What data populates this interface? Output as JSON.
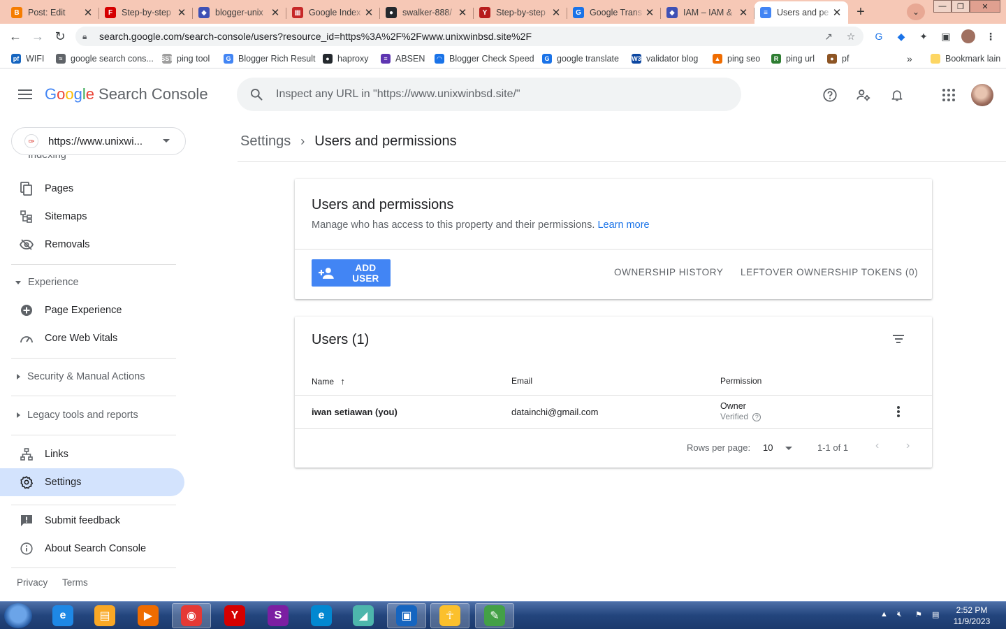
{
  "browser": {
    "tabs": [
      {
        "label": "Post: Edit",
        "fav_color": "#f57c00",
        "fav_glyph": "B"
      },
      {
        "label": "Step-by-step",
        "fav_color": "#d50000",
        "fav_glyph": "F"
      },
      {
        "label": "blogger-unix",
        "fav_color": "#3f51b5",
        "fav_glyph": "◆"
      },
      {
        "label": "Google Index",
        "fav_color": "#c62828",
        "fav_glyph": "▦"
      },
      {
        "label": "swalker-888/",
        "fav_color": "#24292e",
        "fav_glyph": "●"
      },
      {
        "label": "Step-by-step",
        "fav_color": "#b71c1c",
        "fav_glyph": "Y"
      },
      {
        "label": "Google Trans",
        "fav_color": "#1a73e8",
        "fav_glyph": "G"
      },
      {
        "label": "IAM – IAM &",
        "fav_color": "#3f51b5",
        "fav_glyph": "◆"
      },
      {
        "label": "Users and pe",
        "fav_color": "#4285f4",
        "fav_glyph": "≡"
      }
    ],
    "new_tab_glyph": "+",
    "address": "search.google.com/search-console/users?resource_id=https%3A%2F%2Fwww.unixwinbsd.site%2F",
    "bookmarks": [
      {
        "label": "WIFI",
        "color": "#1565c0",
        "glyph": "pf"
      },
      {
        "label": "google search cons...",
        "color": "#5f6368",
        "glyph": "≈"
      },
      {
        "label": "ping tool",
        "color": "#9e9e9e",
        "glyph": "SST"
      },
      {
        "label": "Blogger Rich Result",
        "color": "#4285f4",
        "glyph": "G"
      },
      {
        "label": "haproxy",
        "color": "#24292e",
        "glyph": "●"
      },
      {
        "label": "ABSEN",
        "color": "#5e35b1",
        "glyph": "≡"
      },
      {
        "label": "Blogger Check Speed",
        "color": "#1a73e8",
        "glyph": "◠"
      },
      {
        "label": "google translate",
        "color": "#1a73e8",
        "glyph": "G"
      },
      {
        "label": "validator blog",
        "color": "#0d47a1",
        "glyph": "W3"
      },
      {
        "label": "ping seo",
        "color": "#ef6c00",
        "glyph": "▲"
      },
      {
        "label": "ping url",
        "color": "#2e7d32",
        "glyph": "R"
      },
      {
        "label": "pf",
        "color": "#8d5524",
        "glyph": "●"
      }
    ],
    "bookmarks_overflow": "»",
    "other_bookmarks": "Bookmark lain"
  },
  "app": {
    "logo_google": [
      "G",
      "o",
      "o",
      "g",
      "l",
      "e"
    ],
    "logo_colors": [
      "#4285f4",
      "#ea4335",
      "#fbbc05",
      "#4285f4",
      "#34a853",
      "#ea4335"
    ],
    "logo_product": "Search Console",
    "search_placeholder": "Inspect any URL in \"https://www.unixwinbsd.site/\"",
    "property": "https://www.unixwi...",
    "sidebar": {
      "partial_top": "Indexing",
      "items": {
        "pages": "Pages",
        "sitemaps": "Sitemaps",
        "removals": "Removals",
        "experience": "Experience",
        "page_experience": "Page Experience",
        "core_web_vitals": "Core Web Vitals",
        "security": "Security & Manual Actions",
        "legacy": "Legacy tools and reports",
        "links": "Links",
        "settings": "Settings",
        "submit_feedback": "Submit feedback",
        "about": "About Search Console"
      },
      "privacy": "Privacy",
      "terms": "Terms"
    },
    "breadcrumb": {
      "parent": "Settings",
      "separator": "›",
      "current": "Users and permissions"
    },
    "permissions_card": {
      "title": "Users and permissions",
      "description": "Manage who has access to this property and their permissions.",
      "learn_more": "Learn more",
      "add_user": "ADD USER",
      "ownership_history": "OWNERSHIP HISTORY",
      "leftover_tokens": "LEFTOVER OWNERSHIP TOKENS (0)"
    },
    "users_card": {
      "title": "Users (1)",
      "columns": {
        "name": "Name",
        "email": "Email",
        "permission": "Permission"
      },
      "rows": [
        {
          "name": "iwan setiawan (you)",
          "email": "datainchi@gmail.com",
          "permission": "Owner",
          "status": "Verified"
        }
      ],
      "rows_per_page_label": "Rows per page:",
      "rows_per_page_value": "10",
      "range": "1-1 of 1"
    }
  },
  "taskbar": {
    "time": "2:52 PM",
    "date": "11/9/2023",
    "apps": [
      {
        "name": "ie",
        "color": "#1e88e5",
        "glyph": "e"
      },
      {
        "name": "explorer",
        "color": "#f9a825",
        "glyph": "▤"
      },
      {
        "name": "media",
        "color": "#ef6c00",
        "glyph": "▶"
      },
      {
        "name": "chrome",
        "color": "#e53935",
        "glyph": "◉",
        "active": true
      },
      {
        "name": "yandex",
        "color": "#d50000",
        "glyph": "Y"
      },
      {
        "name": "opera-swirl",
        "color": "#7b1fa2",
        "glyph": "S"
      },
      {
        "name": "edge",
        "color": "#0288d1",
        "glyph": "e"
      },
      {
        "name": "notes",
        "color": "#4db6ac",
        "glyph": "◢"
      },
      {
        "name": "network",
        "color": "#1565c0",
        "glyph": "▣",
        "active": true
      },
      {
        "name": "python",
        "color": "#fbc02d",
        "glyph": "☥",
        "active": true
      },
      {
        "name": "paint",
        "color": "#43a047",
        "glyph": "✎",
        "active": true
      }
    ]
  }
}
